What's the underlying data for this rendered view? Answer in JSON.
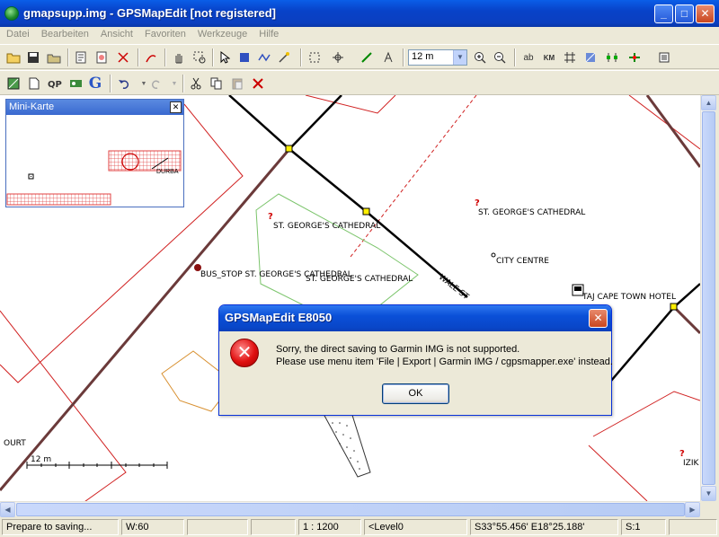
{
  "window": {
    "title": "gmapsupp.img - GPSMapEdit [not registered]",
    "min_label": "_",
    "max_label": "□",
    "close_label": "✕"
  },
  "menu": [
    "Datei",
    "Bearbeiten",
    "Ansicht",
    "Favoriten",
    "Werkzeuge",
    "Hilfe"
  ],
  "toolbar": {
    "zoom_value": "12 m",
    "text_ab": "ab",
    "text_km": "KM",
    "text_google": "G"
  },
  "minimap": {
    "title": "Mini-Karte",
    "label": "DURBA"
  },
  "map": {
    "labels": {
      "cathedral_1": "ST. GEORGE'S CATHEDRAL",
      "cathedral_2": "ST. GEORGE'S CATHEDRAL",
      "bus_stop": "BUS_STOP ST. GEORGE'S CATHEDRAL",
      "cathedral_3": "ST. GEORGE'S CATHEDRAL",
      "city_centre": "CITY CENTRE",
      "hotel": "TAJ CAPE TOWN HOTEL",
      "wale_st": "WALE ST",
      "court": "OURT",
      "izik": "IZIK",
      "scale": "12 m"
    }
  },
  "dialog": {
    "title": "GPSMapEdit E8050",
    "line1": "Sorry, the direct saving to Garmin IMG is not supported.",
    "line2": "Please use menu item 'File | Export | Garmin IMG / cgpsmapper.exe' instead.",
    "ok_label": "OK"
  },
  "status": {
    "message": "Prepare to saving...",
    "w": "W:60",
    "scale": "1 : 1200",
    "level": "<Level0",
    "coords": "S33°55.456' E18°25.188'",
    "s": "S:1"
  }
}
